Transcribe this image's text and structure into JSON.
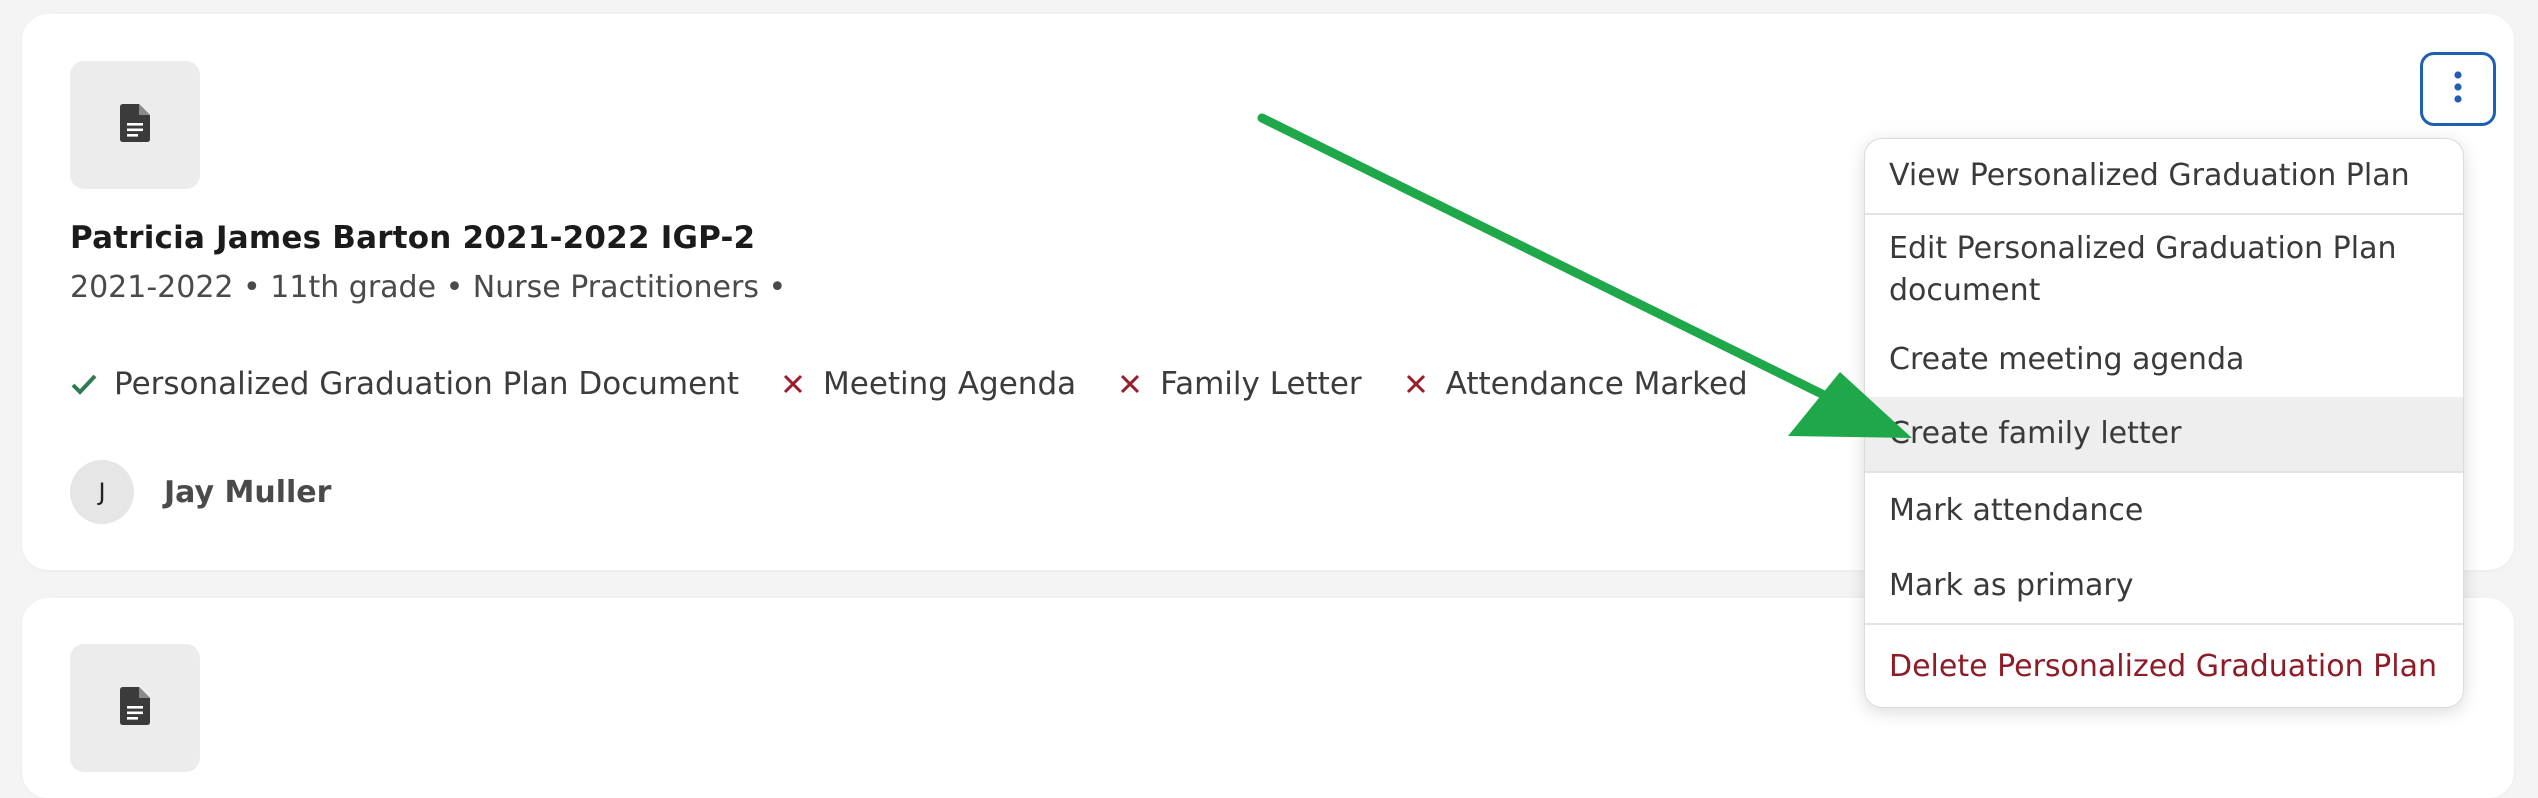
{
  "record": {
    "title": "Patricia James Barton 2021-2022 IGP-2",
    "subtitle": "2021-2022 • 11th grade • Nurse Practitioners •",
    "checklist": [
      {
        "label": "Personalized Graduation Plan Document",
        "status": "complete",
        "icon": "check-icon",
        "color": "#2e7d4f"
      },
      {
        "label": "Meeting Agenda",
        "status": "incomplete",
        "icon": "x-icon",
        "color": "#9b1c2b"
      },
      {
        "label": "Family Letter",
        "status": "incomplete",
        "icon": "x-icon",
        "color": "#9b1c2b"
      },
      {
        "label": "Attendance Marked",
        "status": "incomplete",
        "icon": "x-icon",
        "color": "#9b1c2b"
      }
    ],
    "author": {
      "initial": "J",
      "name": "Jay Muller"
    },
    "document_icon": "document-icon"
  },
  "actions_button": {
    "icon": "kebab-menu-icon",
    "border_color": "#1f5fb2"
  },
  "menu": {
    "items": [
      {
        "label": "View Personalized Graduation Plan"
      },
      {
        "label": "Edit Personalized Graduation Plan document"
      },
      {
        "label": "Create meeting agenda"
      },
      {
        "label": "Create family letter",
        "highlighted": true
      },
      {
        "label": "Mark attendance"
      },
      {
        "label": "Mark as primary"
      },
      {
        "label": "Delete Personalized Graduation Plan",
        "danger": true,
        "color": "#8e1b25"
      }
    ]
  },
  "annotation": {
    "icon": "arrow-icon",
    "color": "#1fa84a"
  },
  "colors": {
    "page_bg": "#f4f4f4",
    "card_bg": "#ffffff",
    "tile_bg": "#ececec",
    "menu_highlight": "#eeeeee"
  }
}
